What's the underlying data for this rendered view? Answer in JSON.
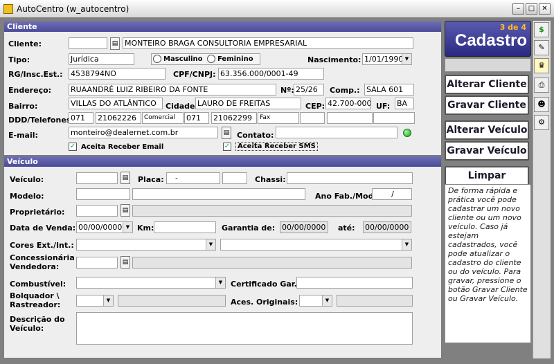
{
  "window": {
    "title": "AutoCentro (w_autocentro)"
  },
  "cliente": {
    "section_title": "Cliente",
    "labels": {
      "cliente": "Cliente:",
      "tipo": "Tipo:",
      "nascimento": "Nascimento:",
      "rg": "RG/Insc.Est.:",
      "cpf": "CPF/CNPJ:",
      "endereco": "Endereço:",
      "num": "Nº:",
      "comp": "Comp.:",
      "bairro": "Bairro:",
      "cidade": "Cidade:",
      "cep": "CEP:",
      "uf": "UF:",
      "ddd": "DDD/Telefones:",
      "email": "E-mail:",
      "contato": "Contato:"
    },
    "nome": "MONTEIRO BRAGA CONSULTORIA EMPRESARIAL",
    "tipo": "Jurídica",
    "sexo_masculino": "Masculino",
    "sexo_feminino": "Feminino",
    "nascimento": "1/01/1990",
    "rg": "4538794NO",
    "cpf": "63.356.000/0001-49",
    "endereco": "RUAANDRÉ LUIZ RIBEIRO DA FONTE",
    "numero": "25/26",
    "complemento": "SALA 601",
    "bairro": "VILLAS DO ATLÂNTICO",
    "cidade": "LAURO DE FREITAS",
    "cep": "42.700-000",
    "uf": "BA",
    "tel1_ddd": "071",
    "tel1_num": "21062226",
    "tel1_tipo": "Comercial",
    "tel2_ddd": "071",
    "tel2_num": "21062299",
    "tel2_tipo": "Fax",
    "email": "monteiro@dealernet.com.br",
    "aceita_email": "Aceita Receber Email",
    "aceita_sms": "Aceita Receber SMS"
  },
  "veiculo": {
    "section_title": "Veículo",
    "labels": {
      "veiculo": "Veículo:",
      "placa": "Placa:",
      "chassi": "Chassi:",
      "modelo": "Modelo:",
      "ano": "Ano Fab./Mod:",
      "proprietario": "Proprietário:",
      "data_venda": "Data de Venda:",
      "km": "Km:",
      "garantia": "Garantia de:",
      "ate": "até:",
      "cores": "Cores Ext./Int.:",
      "concessionaria1": "Concessionária",
      "concessionaria2": "Vendedora:",
      "combustivel": "Combustível:",
      "certificado": "Certificado Gar.:",
      "bloqueador1": "Bolquador \\",
      "bloqueador2": "Rastreador:",
      "acessorios": "Aces. Originais:",
      "descricao1": "Descrição do",
      "descricao2": "Veículo:"
    },
    "placa_sep": "-",
    "ano_sep": "/",
    "data_venda": "00/00/0000",
    "garantia_de": "00/00/0000",
    "garantia_ate": "00/00/0000"
  },
  "sidebar": {
    "logo_step": "3 de 4",
    "logo_title": "Cadastro",
    "buttons": [
      "Alterar Cliente",
      "Gravar Cliente",
      "Alterar Veículo",
      "Gravar Veículo",
      "Limpar"
    ],
    "help": "De forma rápida e prática você pode cadastrar um novo cliente ou um novo veículo. Caso já estejam cadastrados, você pode atualizar o cadastro do cliente ou do veículo. Para gravar, pressione o botão Gravar Cliente ou Gravar Veículo."
  },
  "icons": {
    "app": "app-icon",
    "lookup": "lookup-icon",
    "dollar": "dollar-icon",
    "edit": "edit-icon",
    "chess": "chess-icon",
    "print": "print-icon",
    "face": "face-icon",
    "tools": "tools-icon"
  }
}
